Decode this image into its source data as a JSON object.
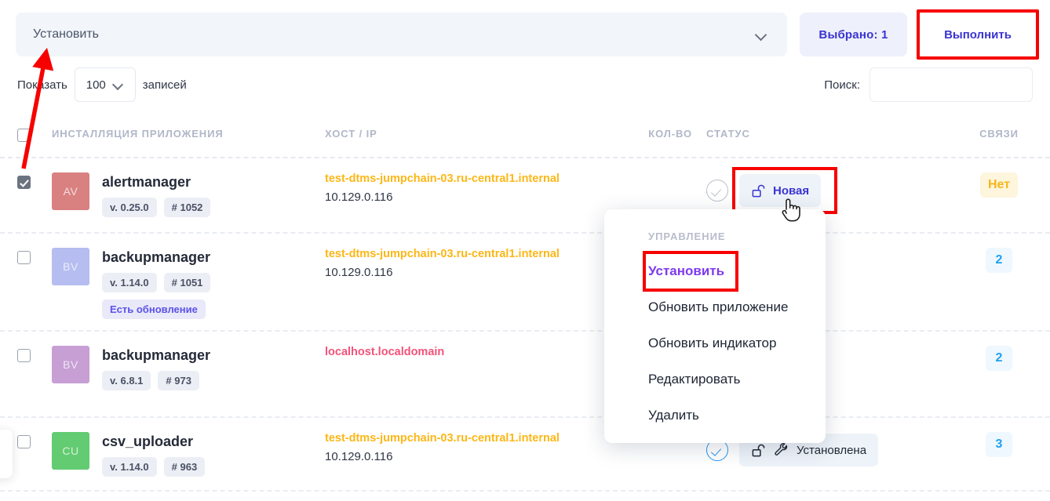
{
  "toolbar": {
    "action_select_value": "Установить",
    "selected_label": "Выбрано:  1",
    "execute_label": "Выполнить"
  },
  "controls": {
    "show_prefix": "Показать",
    "page_length": "100",
    "show_suffix": "записей",
    "search_label": "Поиск:",
    "search_value": "",
    "search_placeholder": ""
  },
  "table": {
    "headers": {
      "app": "ИНСТАЛЛЯЦИЯ ПРИЛОЖЕНИЯ",
      "host": "ХОСТ / IP",
      "qty": "КОЛ-ВО",
      "status": "СТАТУС",
      "links": "СВЯЗИ"
    },
    "rows": [
      {
        "checked": true,
        "avatar": {
          "initials": "AV",
          "color": "#d98080"
        },
        "name": "alertmanager",
        "version": "v. 0.25.0",
        "build": "# 1052",
        "update_badge": "",
        "host": "test-dtms-jumpchain-03.ru-central1.internal",
        "host_kind": "remote",
        "ip": "10.129.0.116",
        "qty": "",
        "check_on": false,
        "status_label": "Новая",
        "status_kind": "new",
        "links": "Нет",
        "links_kind": "none"
      },
      {
        "checked": false,
        "avatar": {
          "initials": "BV",
          "color": "#b6bdf0"
        },
        "name": "backupmanager",
        "version": "v. 1.14.0",
        "build": "# 1051",
        "update_badge": "Есть обновление",
        "host": "test-dtms-jumpchain-03.ru-central1.internal",
        "host_kind": "remote",
        "ip": "10.129.0.116",
        "qty": "",
        "check_on": false,
        "status_label": "",
        "status_kind": "hidden",
        "links": "2",
        "links_kind": "num"
      },
      {
        "checked": false,
        "avatar": {
          "initials": "BV",
          "color": "#c79fd5"
        },
        "name": "backupmanager",
        "version": "v. 6.8.1",
        "build": "# 973",
        "update_badge": "",
        "host": "localhost.localdomain",
        "host_kind": "local",
        "ip": "",
        "qty": "",
        "check_on": false,
        "status_label": "",
        "status_kind": "hidden",
        "links": "2",
        "links_kind": "num"
      },
      {
        "checked": false,
        "avatar": {
          "initials": "CU",
          "color": "#63cb72"
        },
        "name": "csv_uploader",
        "version": "v. 1.14.0",
        "build": "# 963",
        "update_badge": "",
        "host": "test-dtms-jumpchain-03.ru-central1.internal",
        "host_kind": "remote",
        "ip": "10.129.0.116",
        "qty": "",
        "check_on": true,
        "status_label": "Установлена",
        "status_kind": "installed",
        "links": "3",
        "links_kind": "num"
      }
    ]
  },
  "menu": {
    "title": "УПРАВЛЕНИЕ",
    "items": [
      {
        "label": "Установить",
        "active": true
      },
      {
        "label": "Обновить приложение",
        "active": false
      },
      {
        "label": "Обновить индикатор",
        "active": false
      },
      {
        "label": "Редактировать",
        "active": false
      },
      {
        "label": "Удалить",
        "active": false
      }
    ]
  },
  "colors": {
    "accent": "#3a34d2",
    "menu_active": "#7c3aed",
    "highlight": "#f70000",
    "host_remote": "#fcb716",
    "host_local": "#f4527a",
    "links_num": "#1fa0ef",
    "links_none": "#f5b61a"
  }
}
